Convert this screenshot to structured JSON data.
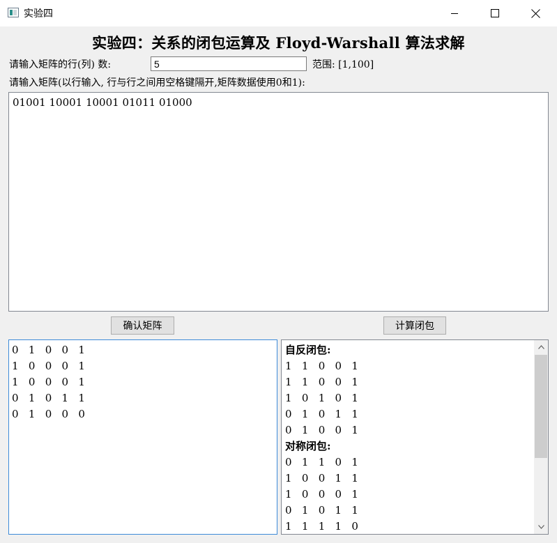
{
  "window": {
    "title": "实验四",
    "controls": {
      "minimize": "minimize-icon",
      "maximize": "maximize-icon",
      "close": "close-icon"
    }
  },
  "heading": "实验四：关系的闭包运算及 Floyd-Warshall 算法求解",
  "size": {
    "label": "请输入矩阵的行(列) 数:",
    "value": "5",
    "range_label": "范围: [1,100]"
  },
  "matrix_input": {
    "label": "请输入矩阵(以行输入, 行与行之间用空格键隔开,矩阵数据使用0和1):",
    "value": "01001 10001 10001 01011 01000"
  },
  "buttons": {
    "confirm": "确认矩阵",
    "compute": "计算闭包"
  },
  "left_output": {
    "rows": [
      "0   1   0   0   1",
      "1   0   0   0   1",
      "1   0   0   0   1",
      "0   1   0   1   1",
      "0   1   0   0   0"
    ]
  },
  "right_output": {
    "reflexive_label": "自反闭包:",
    "reflexive_rows": [
      "1   1   0   0   1",
      "1   1   0   0   1",
      "1   0   1   0   1",
      "0   1   0   1   1",
      "0   1   0   0   1"
    ],
    "symmetric_label": "对称闭包:",
    "symmetric_rows": [
      "0   1   1   0   1",
      "1   0   0   1   1",
      "1   0   0   0   1",
      "0   1   0   1   1",
      "1   1   1   1   0"
    ]
  },
  "colors": {
    "focus_border": "#3c8ad8",
    "window_bg": "#f0f0f0"
  }
}
